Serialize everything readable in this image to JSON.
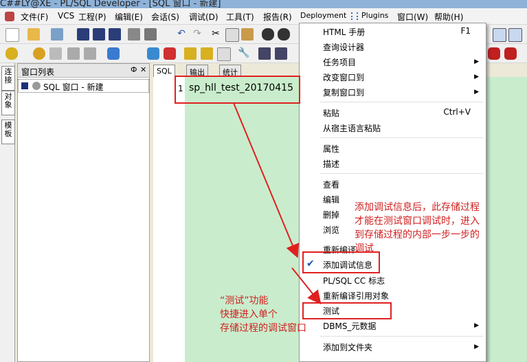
{
  "window": {
    "title": "C##LY@XE - PL/SQL Developer - [SQL 窗口 - 新建]"
  },
  "menubar": {
    "items": [
      "文件(F)",
      "VCS",
      "工程(P)",
      "编辑(E)",
      "会话(S)",
      "调试(D)",
      "工具(T)",
      "报告(R)",
      "Deployment",
      "Plugins",
      "窗口(W)",
      "帮助(H)"
    ]
  },
  "left_tabs": [
    "连接",
    "对象",
    "模板"
  ],
  "window_list": {
    "title": "窗口列表",
    "pin": "Ф",
    "close": "✕",
    "item": "SQL 窗口 - 新建"
  },
  "editor": {
    "tabs": [
      "SQL",
      "输出",
      "统计"
    ],
    "line_number": "1",
    "code": "sp_hll_test_20170415"
  },
  "context_menu": {
    "items": [
      {
        "label": "HTML 手册",
        "shortcut": "F1"
      },
      {
        "label": "查询设计器"
      },
      {
        "label": "任务项目",
        "submenu": true
      },
      {
        "label": "改变窗口到",
        "submenu": true
      },
      {
        "label": "复制窗口到",
        "submenu": true
      },
      {
        "label": "粘贴",
        "shortcut": "Ctrl+V"
      },
      {
        "label": "从宿主语言粘贴"
      },
      {
        "label": "属性"
      },
      {
        "label": "描述"
      },
      {
        "label": "查看"
      },
      {
        "label": "编辑"
      },
      {
        "label": "删掉"
      },
      {
        "label": "浏览"
      },
      {
        "label": "重新编译"
      },
      {
        "label": "添加调试信息",
        "checked": true
      },
      {
        "label": "PL/SQL CC 标志"
      },
      {
        "label": "重新编译引用对象"
      },
      {
        "label": "测试"
      },
      {
        "label": "DBMS_元数据",
        "submenu": true
      },
      {
        "label": "添加到文件夹",
        "submenu": true
      }
    ]
  },
  "annotations": {
    "right": [
      "添加调试信息后，此存储过程",
      "才能在测试窗口调试时，进入",
      "到存储过程的内部一步一步的",
      "调试"
    ],
    "left": [
      "“测试”功能",
      "快捷进入单个",
      "存储过程的调试窗口"
    ]
  },
  "colors": {
    "annotation": "#e02020",
    "editor_bg": "#c9edcc"
  }
}
